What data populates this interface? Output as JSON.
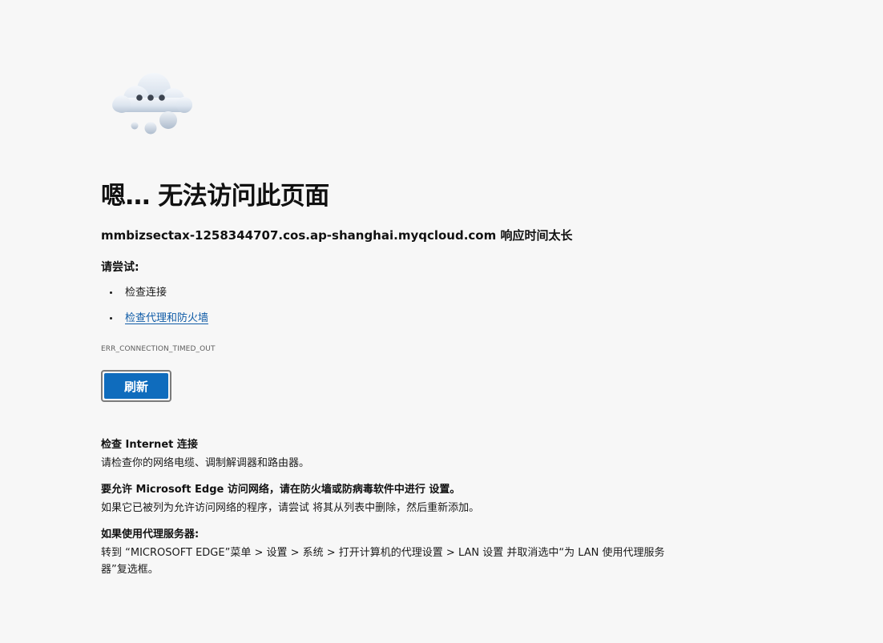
{
  "icon": {
    "name": "cloud-thinking-icon"
  },
  "error": {
    "headline": "嗯… 无法访问此页面",
    "host_line": "mmbizsectax-1258344707.cos.ap-shanghai.myqcloud.com 响应时间太长",
    "try_label": "请尝试:",
    "suggestions": [
      {
        "text": "检查连接",
        "link": false
      },
      {
        "text": "检查代理和防火墙",
        "link": true
      }
    ],
    "code": "ERR_CONNECTION_TIMED_OUT"
  },
  "actions": {
    "refresh_label": "刷新"
  },
  "details": [
    {
      "title": "检查 Internet 连接",
      "text": "请检查你的网络电缆、调制解调器和路由器。"
    },
    {
      "title": "要允许 Microsoft Edge 访问网络，请在防火墙或防病毒软件中进行 设置。",
      "text": "如果它已被列为允许访问网络的程序，请尝试 将其从列表中删除，然后重新添加。"
    },
    {
      "title": "如果使用代理服务器:",
      "text": "转到 “MICROSOFT EDGE”菜单 > 设置 > 系统 > 打开计算机的代理设置 > LAN 设置 并取消选中“为 LAN 使用代理服务器”复选框。"
    }
  ],
  "colors": {
    "background": "#f7f7f7",
    "accent": "#0f6cbd",
    "link": "#0f5ba7"
  }
}
